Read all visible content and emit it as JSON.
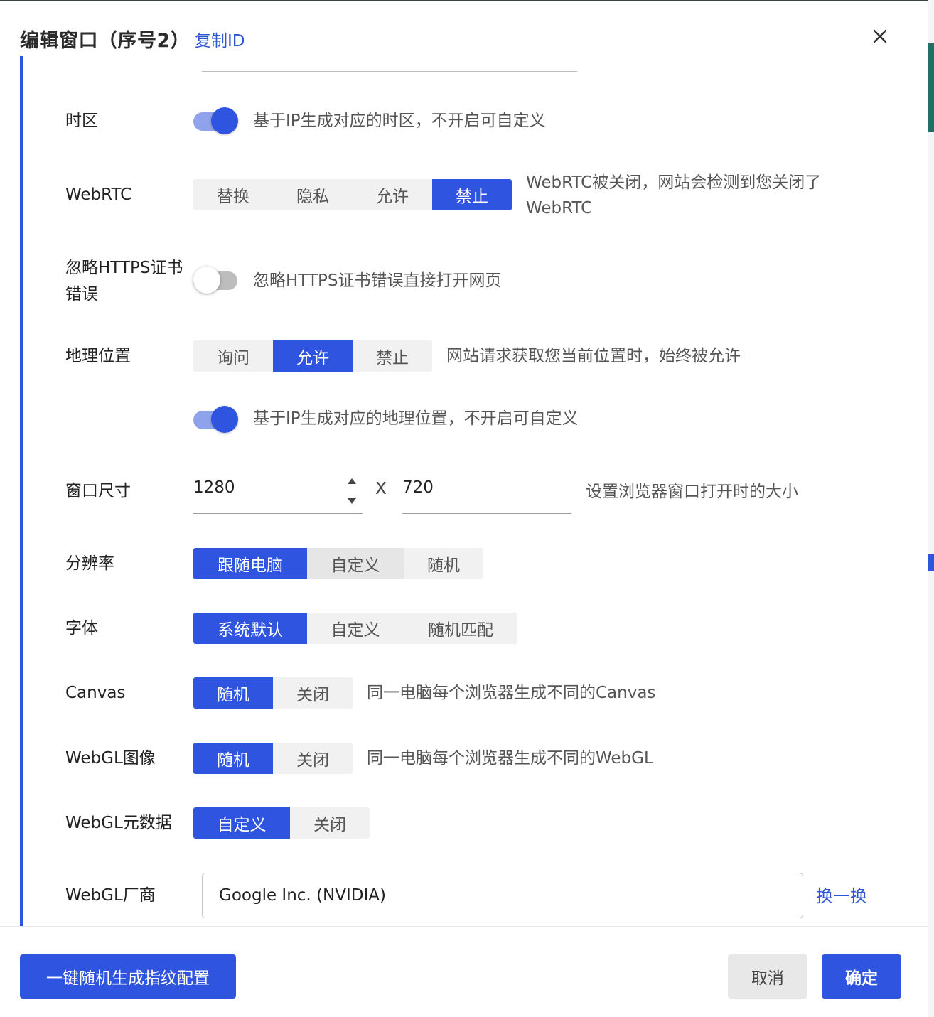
{
  "dialog": {
    "title": "编辑窗口（序号2）",
    "copy_id": "复制ID"
  },
  "timezone": {
    "label": "时区",
    "toggle_on": true,
    "desc": "基于IP生成对应的时区，不开启可自定义"
  },
  "webrtc": {
    "label": "WebRTC",
    "options": [
      "替换",
      "隐私",
      "允许",
      "禁止"
    ],
    "selected": "禁止",
    "desc_line1": "WebRTC被关闭，网站会检测到您关闭了",
    "desc_line2": "WebRTC"
  },
  "https": {
    "label_line1": "忽略HTTPS证书",
    "label_line2": "错误",
    "toggle_on": false,
    "desc": "忽略HTTPS证书错误直接打开网页"
  },
  "geo": {
    "label": "地理位置",
    "options": [
      "询问",
      "允许",
      "禁止"
    ],
    "selected": "允许",
    "desc": "网站请求获取您当前位置时，始终被允许",
    "toggle_on": true,
    "toggle_desc": "基于IP生成对应的地理位置，不开启可自定义"
  },
  "window_size": {
    "label": "窗口尺寸",
    "width": "1280",
    "separator": "X",
    "height": "720",
    "desc": "设置浏览器窗口打开时的大小"
  },
  "resolution": {
    "label": "分辨率",
    "options": [
      "跟随电脑",
      "自定义",
      "随机"
    ],
    "selected": "跟随电脑"
  },
  "font": {
    "label": "字体",
    "options": [
      "系统默认",
      "自定义",
      "随机匹配"
    ],
    "selected": "系统默认"
  },
  "canvas": {
    "label": "Canvas",
    "options": [
      "随机",
      "关闭"
    ],
    "selected": "随机",
    "desc": "同一电脑每个浏览器生成不同的Canvas"
  },
  "webgl_image": {
    "label": "WebGL图像",
    "options": [
      "随机",
      "关闭"
    ],
    "selected": "随机",
    "desc": "同一电脑每个浏览器生成不同的WebGL"
  },
  "webgl_meta": {
    "label": "WebGL元数据",
    "options": [
      "自定义",
      "关闭"
    ],
    "selected": "自定义"
  },
  "webgl_vendor": {
    "label": "WebGL厂商",
    "value": "Google Inc. (NVIDIA)",
    "swap_link": "换一换"
  },
  "footer": {
    "random_button": "一键随机生成指纹配置",
    "cancel_button": "取消",
    "ok_button": "确定"
  },
  "colors": {
    "accent": "#2f55e0",
    "link": "#2d55d8",
    "segment_bg": "#f1f1f1"
  }
}
